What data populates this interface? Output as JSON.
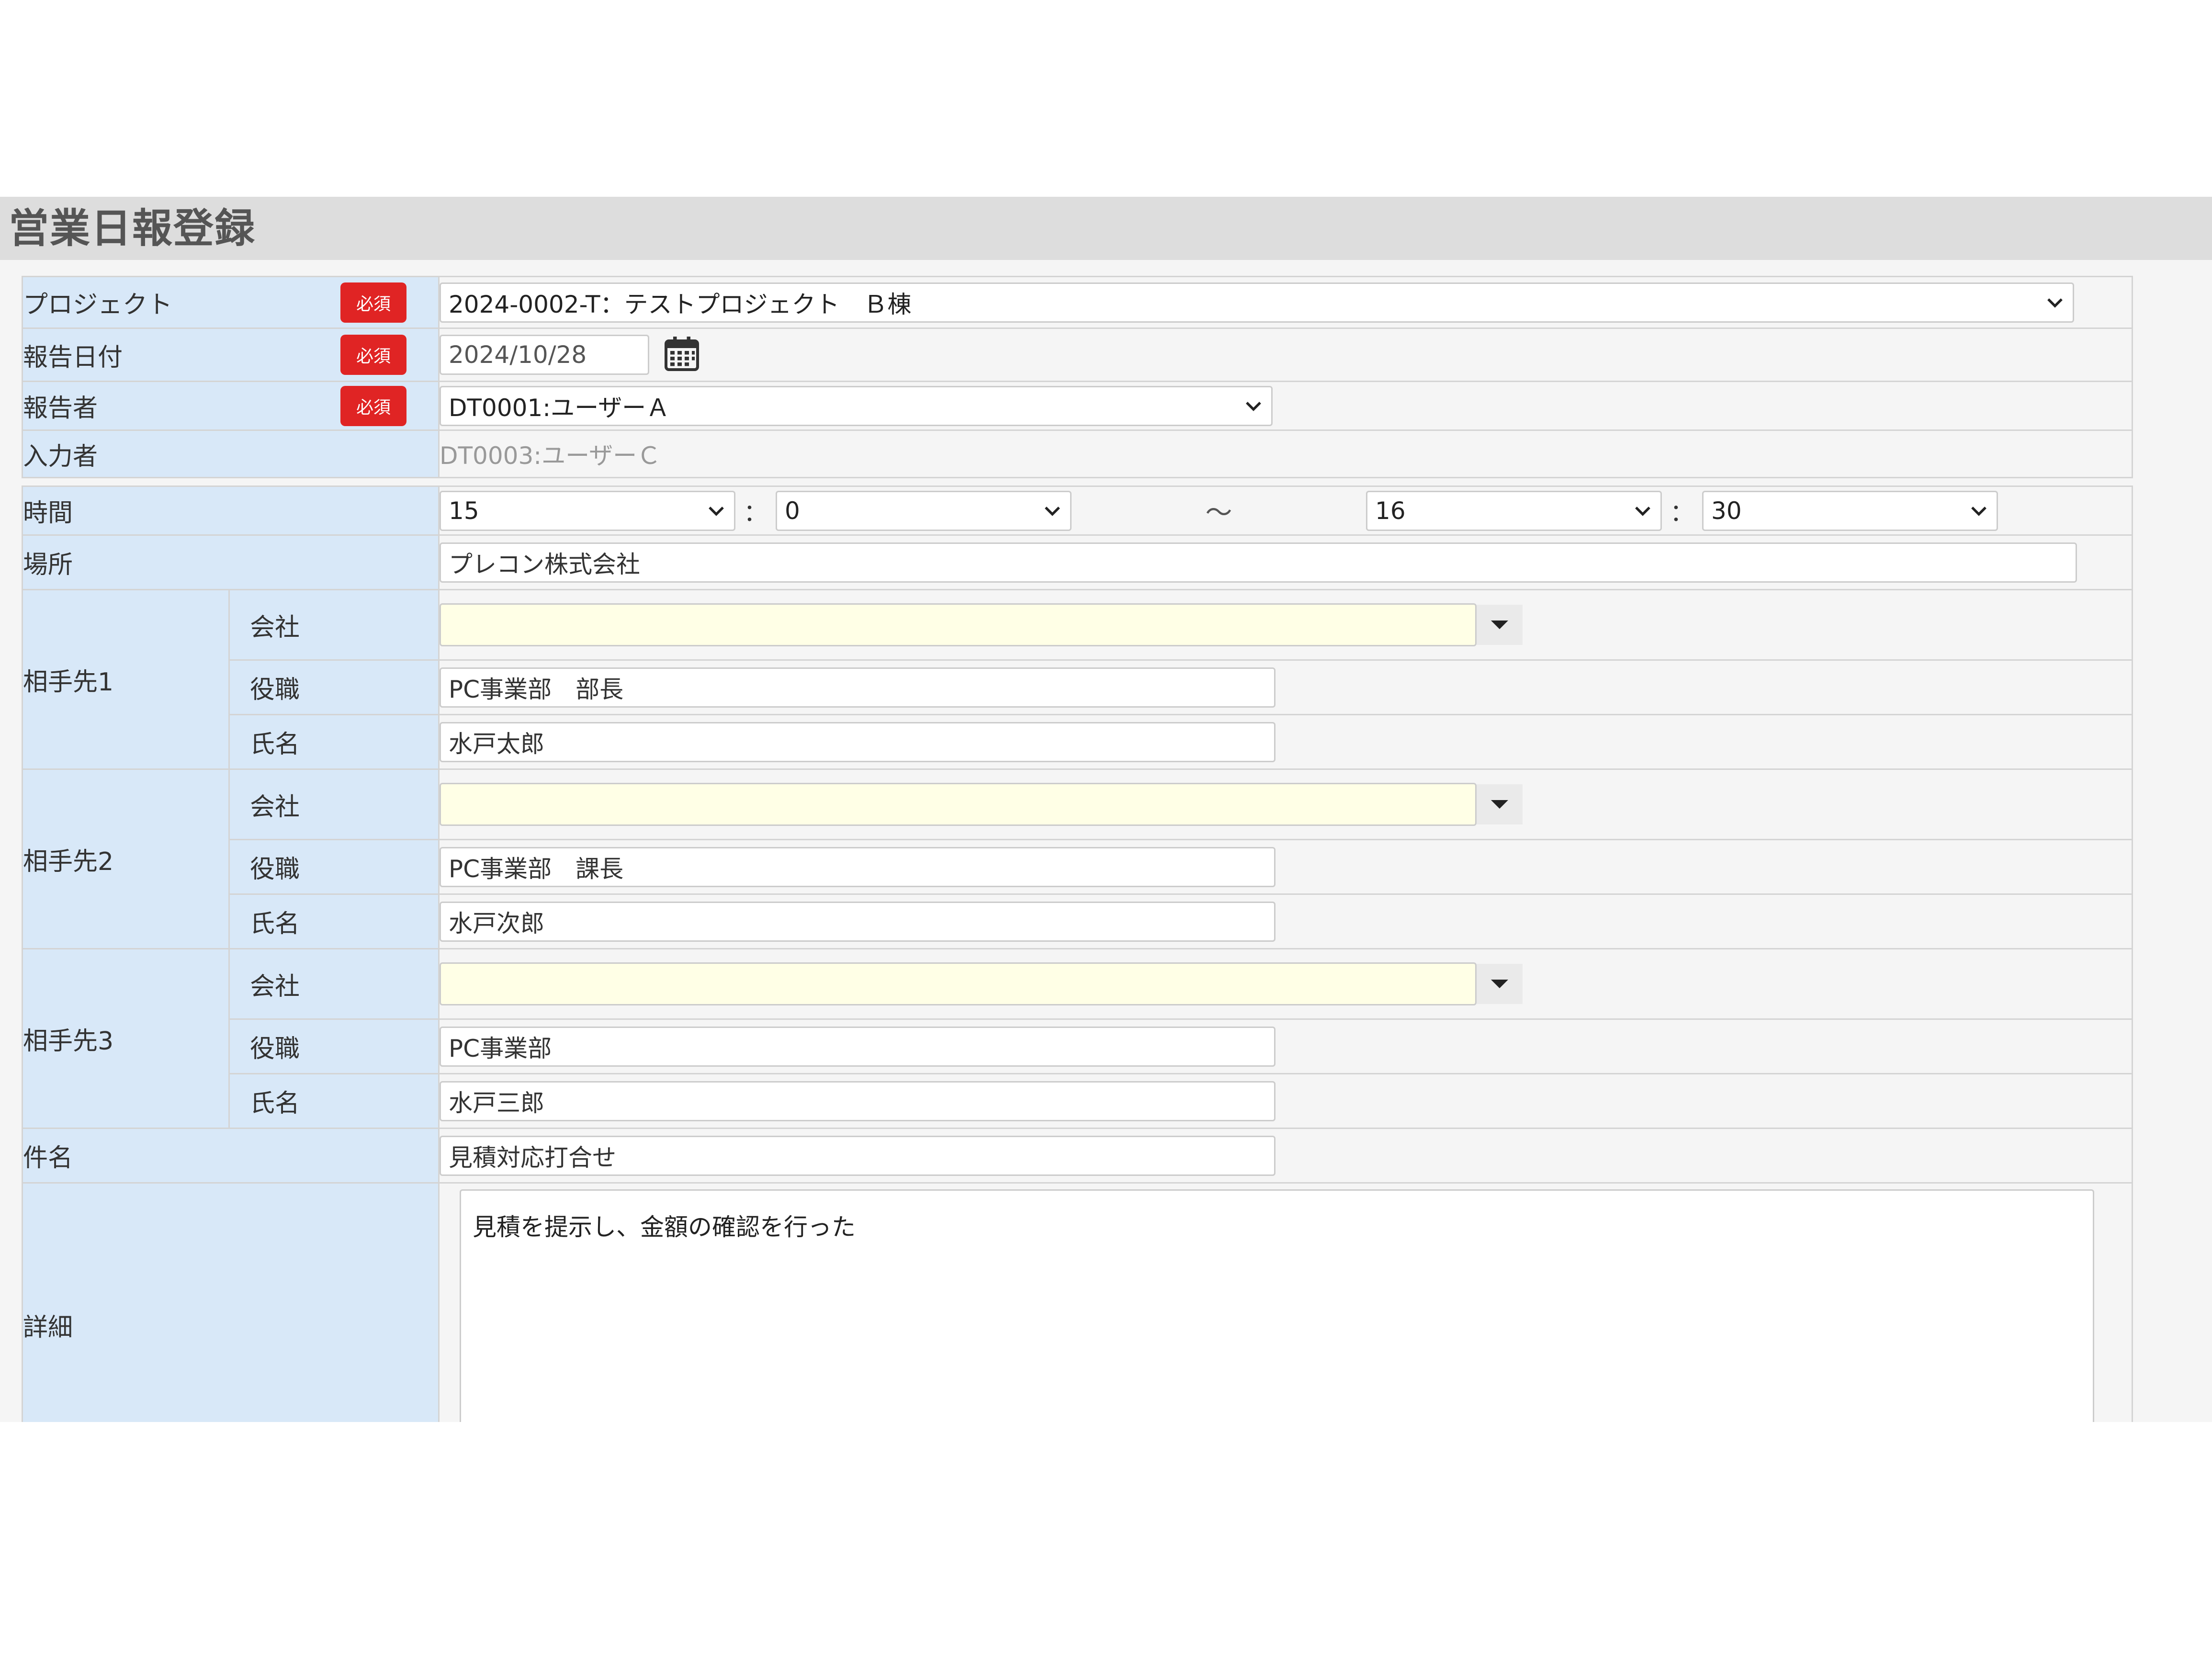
{
  "page": {
    "title": "営業日報登録"
  },
  "required_badge": "必須",
  "project": {
    "label": "プロジェクト",
    "value": "2024-0002-T：テストプロジェクト　Ｂ棟"
  },
  "report_date": {
    "label": "報告日付",
    "value": "2024/10/28"
  },
  "reporter": {
    "label": "報告者",
    "value": "DT0001:ユーザーＡ"
  },
  "entered_by": {
    "label": "入力者",
    "value": "DT0003:ユーザーＣ"
  },
  "time": {
    "label": "時間",
    "start_hour": "15",
    "start_minute": "0",
    "separator": "：",
    "range": "～",
    "end_hour": "16",
    "end_minute": "30"
  },
  "place": {
    "label": "場所",
    "value": "プレコン株式会社"
  },
  "field_labels": {
    "company": "会社",
    "position": "役職",
    "name": "氏名"
  },
  "contacts": [
    {
      "label": "相手先1",
      "company": "",
      "position": "PC事業部　部長",
      "name": "水戸太郎"
    },
    {
      "label": "相手先2",
      "company": "",
      "position": "PC事業部　課長",
      "name": "水戸次郎"
    },
    {
      "label": "相手先3",
      "company": "",
      "position": "PC事業部",
      "name": "水戸三郎"
    }
  ],
  "subject": {
    "label": "件名",
    "value": "見積対応打合せ"
  },
  "detail": {
    "label": "詳細",
    "value": "見積を提示し、金額の確認を行った"
  },
  "colors": {
    "label_bg": "#d8e8f8",
    "required": "#e02424",
    "title_bar": "#dddddd",
    "company_input": "#ffffe6"
  }
}
